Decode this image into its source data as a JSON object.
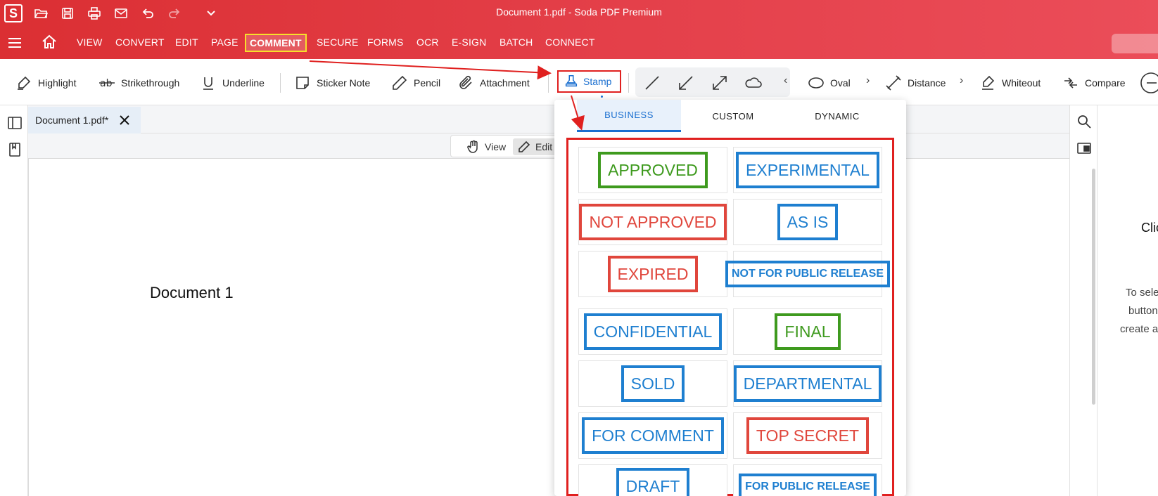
{
  "window": {
    "title": "Document 1.pdf   -   Soda PDF Premium",
    "logo": "S"
  },
  "quick_access": [
    {
      "name": "open-folder-icon"
    },
    {
      "name": "save-icon"
    },
    {
      "name": "print-icon"
    },
    {
      "name": "mail-icon"
    },
    {
      "name": "undo-icon"
    },
    {
      "name": "redo-icon"
    },
    {
      "name": "chevron-down-icon"
    }
  ],
  "menu": {
    "items": [
      "VIEW",
      "CONVERT",
      "EDIT",
      "PAGE",
      "COMMENT",
      "SECURE",
      "FORMS",
      "OCR",
      "E-SIGN",
      "BATCH",
      "CONNECT"
    ],
    "active": "COMMENT"
  },
  "ribbon": {
    "highlight": "Highlight",
    "strikethrough": "Strikethrough",
    "underline": "Underline",
    "sticker_note": "Sticker Note",
    "pencil": "Pencil",
    "attachment": "Attachment",
    "stamp": "Stamp",
    "oval": "Oval",
    "distance": "Distance",
    "whiteout": "Whiteout",
    "compare": "Compare",
    "chev_left": "‹",
    "chev_right": "›"
  },
  "document_tab": {
    "label": "Document 1.pdf*"
  },
  "view_toolbar": {
    "view": "View",
    "edit": "Edit"
  },
  "page": {
    "text": "Document 1"
  },
  "right_panel": {
    "title": "Clic",
    "lines": [
      "To sele",
      "button",
      "create a"
    ]
  },
  "stamp_menu": {
    "tabs": [
      "BUSINESS",
      "CUSTOM",
      "DYNAMIC"
    ],
    "active_tab": "BUSINESS",
    "stamps": [
      {
        "label": "APPROVED",
        "color": "#3e9a1e"
      },
      {
        "label": "EXPERIMENTAL",
        "color": "#1e7fd0"
      },
      {
        "label": "NOT APPROVED",
        "color": "#e0463c"
      },
      {
        "label": "AS IS",
        "color": "#1e7fd0"
      },
      {
        "label": "EXPIRED",
        "color": "#e0463c"
      },
      {
        "label": "NOT FOR PUBLIC RELEASE",
        "color": "#1e7fd0"
      },
      {
        "label": "CONFIDENTIAL",
        "color": "#1e7fd0"
      },
      {
        "label": "FINAL",
        "color": "#3e9a1e"
      },
      {
        "label": "SOLD",
        "color": "#1e7fd0"
      },
      {
        "label": "DEPARTMENTAL",
        "color": "#1e7fd0"
      },
      {
        "label": "FOR COMMENT",
        "color": "#1e7fd0"
      },
      {
        "label": "TOP SECRET",
        "color": "#e0463c"
      },
      {
        "label": "DRAFT",
        "color": "#1e7fd0"
      },
      {
        "label": "FOR PUBLIC RELEASE",
        "color": "#1e7fd0"
      }
    ]
  },
  "colors": {
    "brand_red": "#db2f33",
    "accent_blue": "#1a6fd0",
    "highlight_yellow": "#f7e02a",
    "annotation_red": "#e0201f"
  }
}
